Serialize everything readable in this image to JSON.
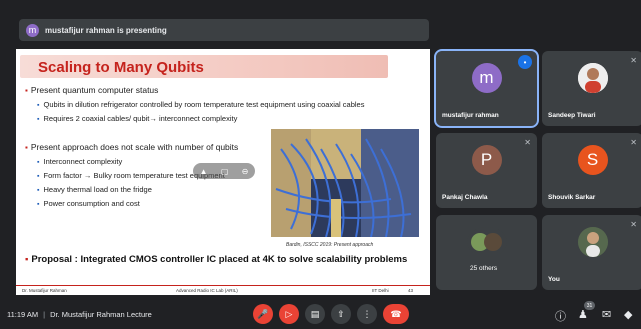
{
  "presenter": {
    "avatar_letter": "m",
    "text": "mustafijur rahman is presenting"
  },
  "slide": {
    "title": "Scaling to Many Qubits",
    "sections": [
      {
        "heading": "Present quantum computer status",
        "bullets": [
          "Qubits in dilution refrigerator controlled by room temperature test equipment using coaxial cables",
          "Requires 2 coaxial cables/ qubit→ interconnect complexity"
        ]
      },
      {
        "heading": "Present approach does not scale with number of qubits",
        "bullets": [
          "Interconnect complexity",
          "Form factor → Bulky room temperature test equipment",
          "Heavy thermal load on the fridge",
          "Power consumption and cost"
        ]
      }
    ],
    "caption": "Bardin, ISSCC 2019: Present approach",
    "proposal": "Proposal : Integrated CMOS controller IC placed at 4K to solve scalability problems",
    "footer": {
      "left": "Dr. Mustafijur Rahman",
      "center": "Advanced Radio IC Lab (ARIL)",
      "right": "IIT Delhi",
      "page": "43"
    }
  },
  "participants": [
    {
      "name": "mustafijur rahman",
      "letter": "m",
      "color": "#8e6cc7",
      "speaking": true
    },
    {
      "name": "Sandeep Tiwari",
      "letter": "",
      "color": "#6b6b6b",
      "speaking": false
    },
    {
      "name": "Pankaj Chawla",
      "letter": "P",
      "color": "#8d5a4a",
      "speaking": false
    },
    {
      "name": "Shouvik Sarkar",
      "letter": "S",
      "color": "#e8541e",
      "speaking": false
    },
    {
      "name": "25 others",
      "letter": "",
      "color": "#5f6368",
      "speaking": false
    },
    {
      "name": "You",
      "letter": "",
      "color": "#4a5a48",
      "speaking": false
    }
  ],
  "bottom": {
    "time": "11:19 AM",
    "meeting": "Dr. Mustafijur Rahman Lecture",
    "participant_count": "31"
  },
  "icons": {
    "mic_off": "mic-off-icon",
    "cam_off": "camera-off-icon",
    "captions": "captions-icon",
    "present": "present-icon",
    "more": "more-vert-icon",
    "hangup": "phone-hangup-icon",
    "info": "info-icon",
    "people": "people-icon",
    "chat": "chat-icon",
    "activities": "activities-icon"
  }
}
